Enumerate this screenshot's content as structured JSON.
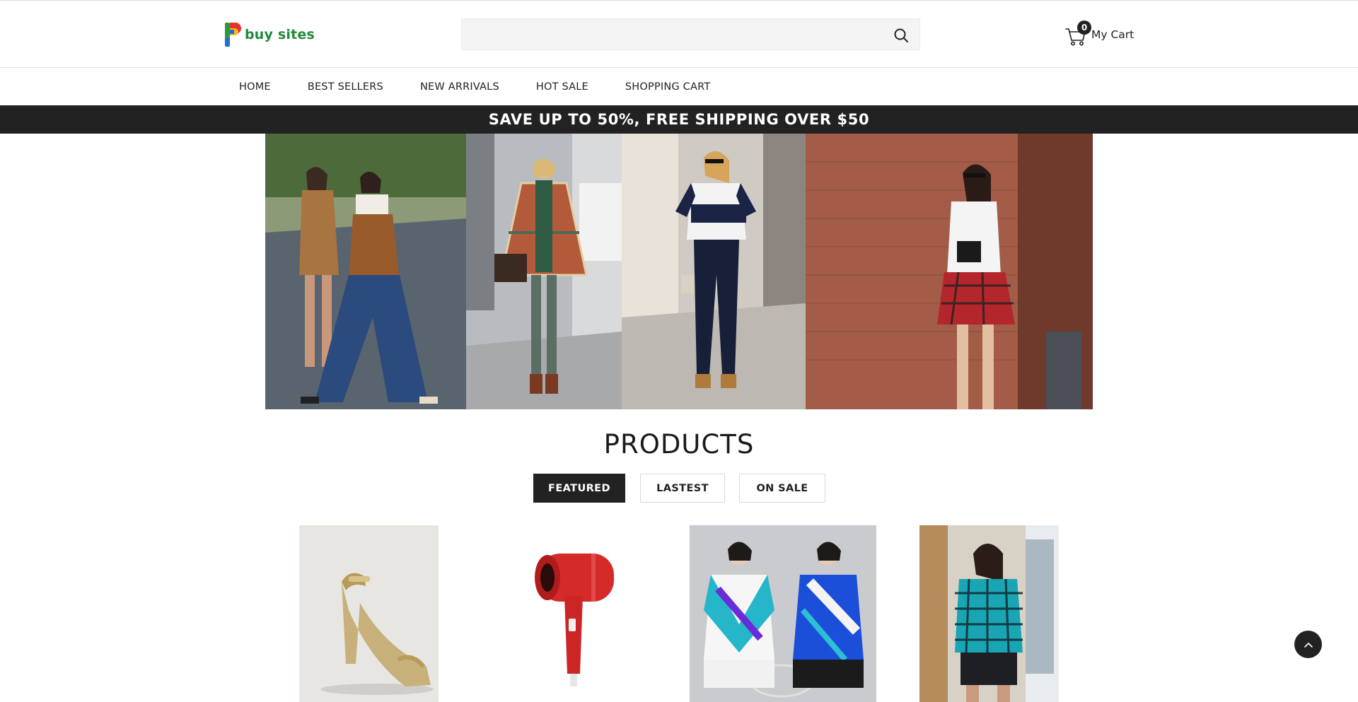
{
  "header": {
    "logo_text": "buy sites",
    "search": {
      "value": "",
      "placeholder": ""
    },
    "cart": {
      "count": "0",
      "label": "My Cart"
    }
  },
  "nav": {
    "items": [
      {
        "label": "HOME"
      },
      {
        "label": "BEST SELLERS"
      },
      {
        "label": "NEW ARRIVALS"
      },
      {
        "label": "HOT SALE"
      },
      {
        "label": "SHOPPING CART"
      }
    ]
  },
  "promo": {
    "text": "SAVE UP TO 50%, FREE SHIPPING OVER $50"
  },
  "products": {
    "title": "PRODUCTS",
    "tabs": [
      {
        "label": "FEATURED",
        "active": true
      },
      {
        "label": "LASTEST",
        "active": false
      },
      {
        "label": "ON SALE",
        "active": false
      }
    ]
  },
  "colors": {
    "dark": "#222222",
    "logo_green": "#1f8a3a",
    "search_bg": "#f4f4f4"
  },
  "icons": {
    "search": "search-icon",
    "cart": "cart-icon",
    "back_to_top": "chevron-up-icon"
  }
}
